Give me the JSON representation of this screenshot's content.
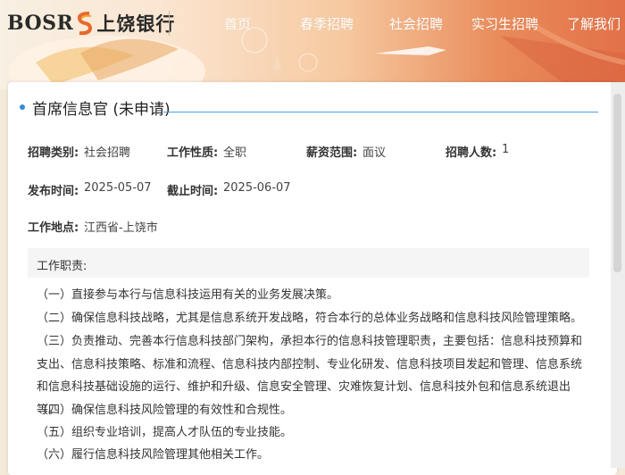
{
  "header": {
    "logo_latin": "BOSR",
    "logo_chinese": "上饶银行",
    "nav": [
      "首页",
      "春季招聘",
      "社会招聘",
      "实习生招聘",
      "了解我们"
    ]
  },
  "job": {
    "title": "首席信息官 (未申请)",
    "fields": [
      {
        "label": "招聘类别:",
        "value": "社会招聘"
      },
      {
        "label": "工作性质:",
        "value": "全职"
      },
      {
        "label": "薪资范围:",
        "value": "面议"
      },
      {
        "label": "招聘人数:",
        "value": "1"
      },
      {
        "label": "发布时间:",
        "value": "2025-05-07"
      },
      {
        "label": "截止时间:",
        "value": "2025-06-07"
      },
      {
        "label": "工作地点:",
        "value": "江西省-上饶市"
      }
    ],
    "duties_heading": "工作职责:",
    "duties": [
      "（一）直接参与本行与信息科技运用有关的业务发展决策。",
      "（二）确保信息科技战略，尤其是信息系统开发战略，符合本行的总体业务战略和信息科技风险管理策略。",
      "（三）负责推动、完善本行信息科技部门架构，承担本行的信息科技管理职责，主要包括：信息科技预算和支出、信息科技策略、标准和流程、信息科技内部控制、专业化研发、信息科技项目发起和管理、信息系统和信息科技基础设施的运行、维护和升级、信息安全管理、灾难恢复计划、信息科技外包和信息系统退出等。",
      "（四）确保信息科技风险管理的有效性和合规性。",
      "（五）组织专业培训，提高人才队伍的专业技能。",
      "（六）履行信息科技风险管理其他相关工作。"
    ]
  },
  "colors": {
    "accent": "#2a8ed8",
    "banner_orange": "#e27148"
  }
}
